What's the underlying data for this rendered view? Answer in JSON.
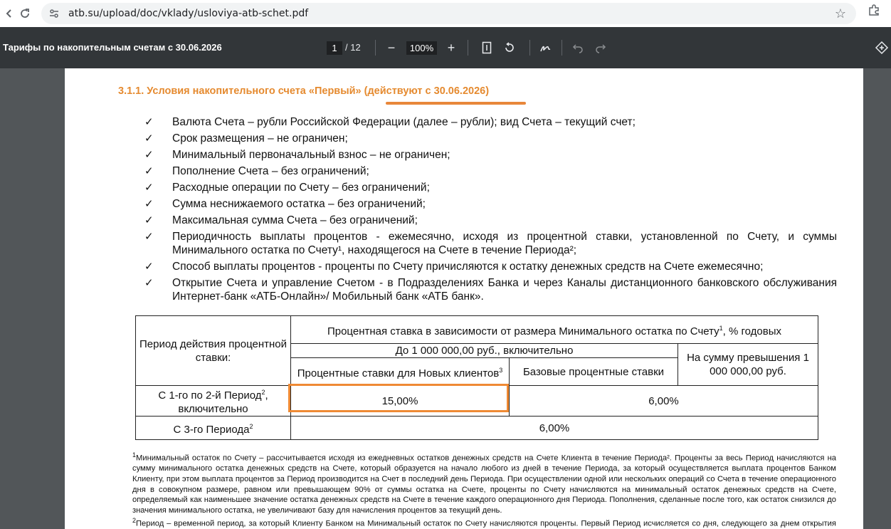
{
  "browser": {
    "url": "atb.su/upload/doc/vklady/usloviya-atb-schet.pdf",
    "icons": [
      "back-icon",
      "reload-icon",
      "site-info-icon",
      "star-icon",
      "extensions-icon"
    ]
  },
  "pdf_toolbar": {
    "title": "Тарифы по накопительным счетам с 30.06.2026",
    "page_current": "1",
    "page_total": "/ 12",
    "zoom_out": "−",
    "zoom": "100%",
    "zoom_in": "+",
    "icons": [
      "fit-page-icon",
      "rotate-icon",
      "draw-icon",
      "undo-icon",
      "redo-icon",
      "save-icon"
    ]
  },
  "document": {
    "section_title": "3.1.1. Условия накопительного счета «Первый» (действуют с 30.06.2026)",
    "check_mark": "✓",
    "items": [
      "Валюта Счета – рубли Российской Федерации (далее – рубли); вид Счета – текущий счет;",
      "Срок размещения – не ограничен;",
      "Минимальный первоначальный взнос – не ограничен;",
      "Пополнение Счета – без ограничений;",
      "Расходные операции по Счету – без ограничений;",
      "Сумма неснижаемого остатка – без ограничений;",
      "Максимальная сумма Счета – без ограничений;",
      "Периодичность выплаты процентов - ежемесячно, исходя из процентной ставки, установленной по Счету, и суммы Минимального остатка по Счету¹, находящегося на Счете в течение Периода²;",
      "Способ выплаты процентов - проценты по Счету причисляются к остатку денежных средств на Счете ежемесячно;",
      "Открытие Счета и управление Счетом - в Подразделениях Банка и через Каналы дистанционного банковского обслуживания Интернет-банк «АТБ-Онлайн»/ Мобильный банк «АТБ банк»."
    ],
    "table": {
      "period_header": "Период действия процентной ставки:",
      "rate_header_main": "Процентная ставка в зависимости от размера Минимального остатка по Счету",
      "rate_header_sup": "1",
      "rate_header_tail": ", % годовых",
      "upto_header": "До 1 000 000,00 руб., включительно",
      "over_header": "На сумму превышения 1 000 000,00 руб.",
      "new_clients_header": "Процентные ставки для Новых клиентов",
      "new_clients_sup": "3",
      "base_header": "Базовые процентные ставки",
      "row1_period": "С 1-го по 2-й Период",
      "row1_sup": "2",
      "row1_tail": ", включительно",
      "row1_new": "15,00%",
      "row1_base": "6,00%",
      "row2_period": "С 3-го Периода",
      "row2_sup": "2",
      "row2_rate": "6,00%"
    },
    "footnote1_mark": "1",
    "footnote1": "Минимальный остаток по Счету – рассчитывается исходя из ежедневных остатков денежных средств на Счете Клиента в течение Периода². Проценты за весь Период начисляются на сумму минимального остатка денежных средств на Счете, который образуется на начало любого из дней в течение Периода, за который осуществляется выплата процентов Банком Клиенту, при этом выплата процентов за Период производится на Счет в последний день Периода. При осуществлении одной или нескольких операций со Счета в течение операционного дня в совокупном размере, равном или превышающем 90% от суммы остатка на Счете, проценты по Счету начисляются на минимальный остаток денежных средств на Счете, определяемый как наименьшее значение остатка денежных средств на Счете в течение каждого операционного дня Периода. Пополнения, сделанные после того, как остаток снизился до значения минимального остатка, не увеличивают базу для начисления процентов за текущий день.",
    "footnote2_mark": "2",
    "footnote2": "Период – временной период, за который Клиенту Банком на Минимальный остаток по Счету начисляются проценты. Первый Период исчисляется со дня, следующего за днем открытия Счета, до последнего календарного дня месяца, в котором начался первый период. Последующие Периоды исчисляются ежемесячно с 1-го числа каждого календарного"
  },
  "colors": {
    "accent_orange": "#e58a2f",
    "toolbar_bg": "#323639",
    "viewer_bg": "#525659"
  }
}
